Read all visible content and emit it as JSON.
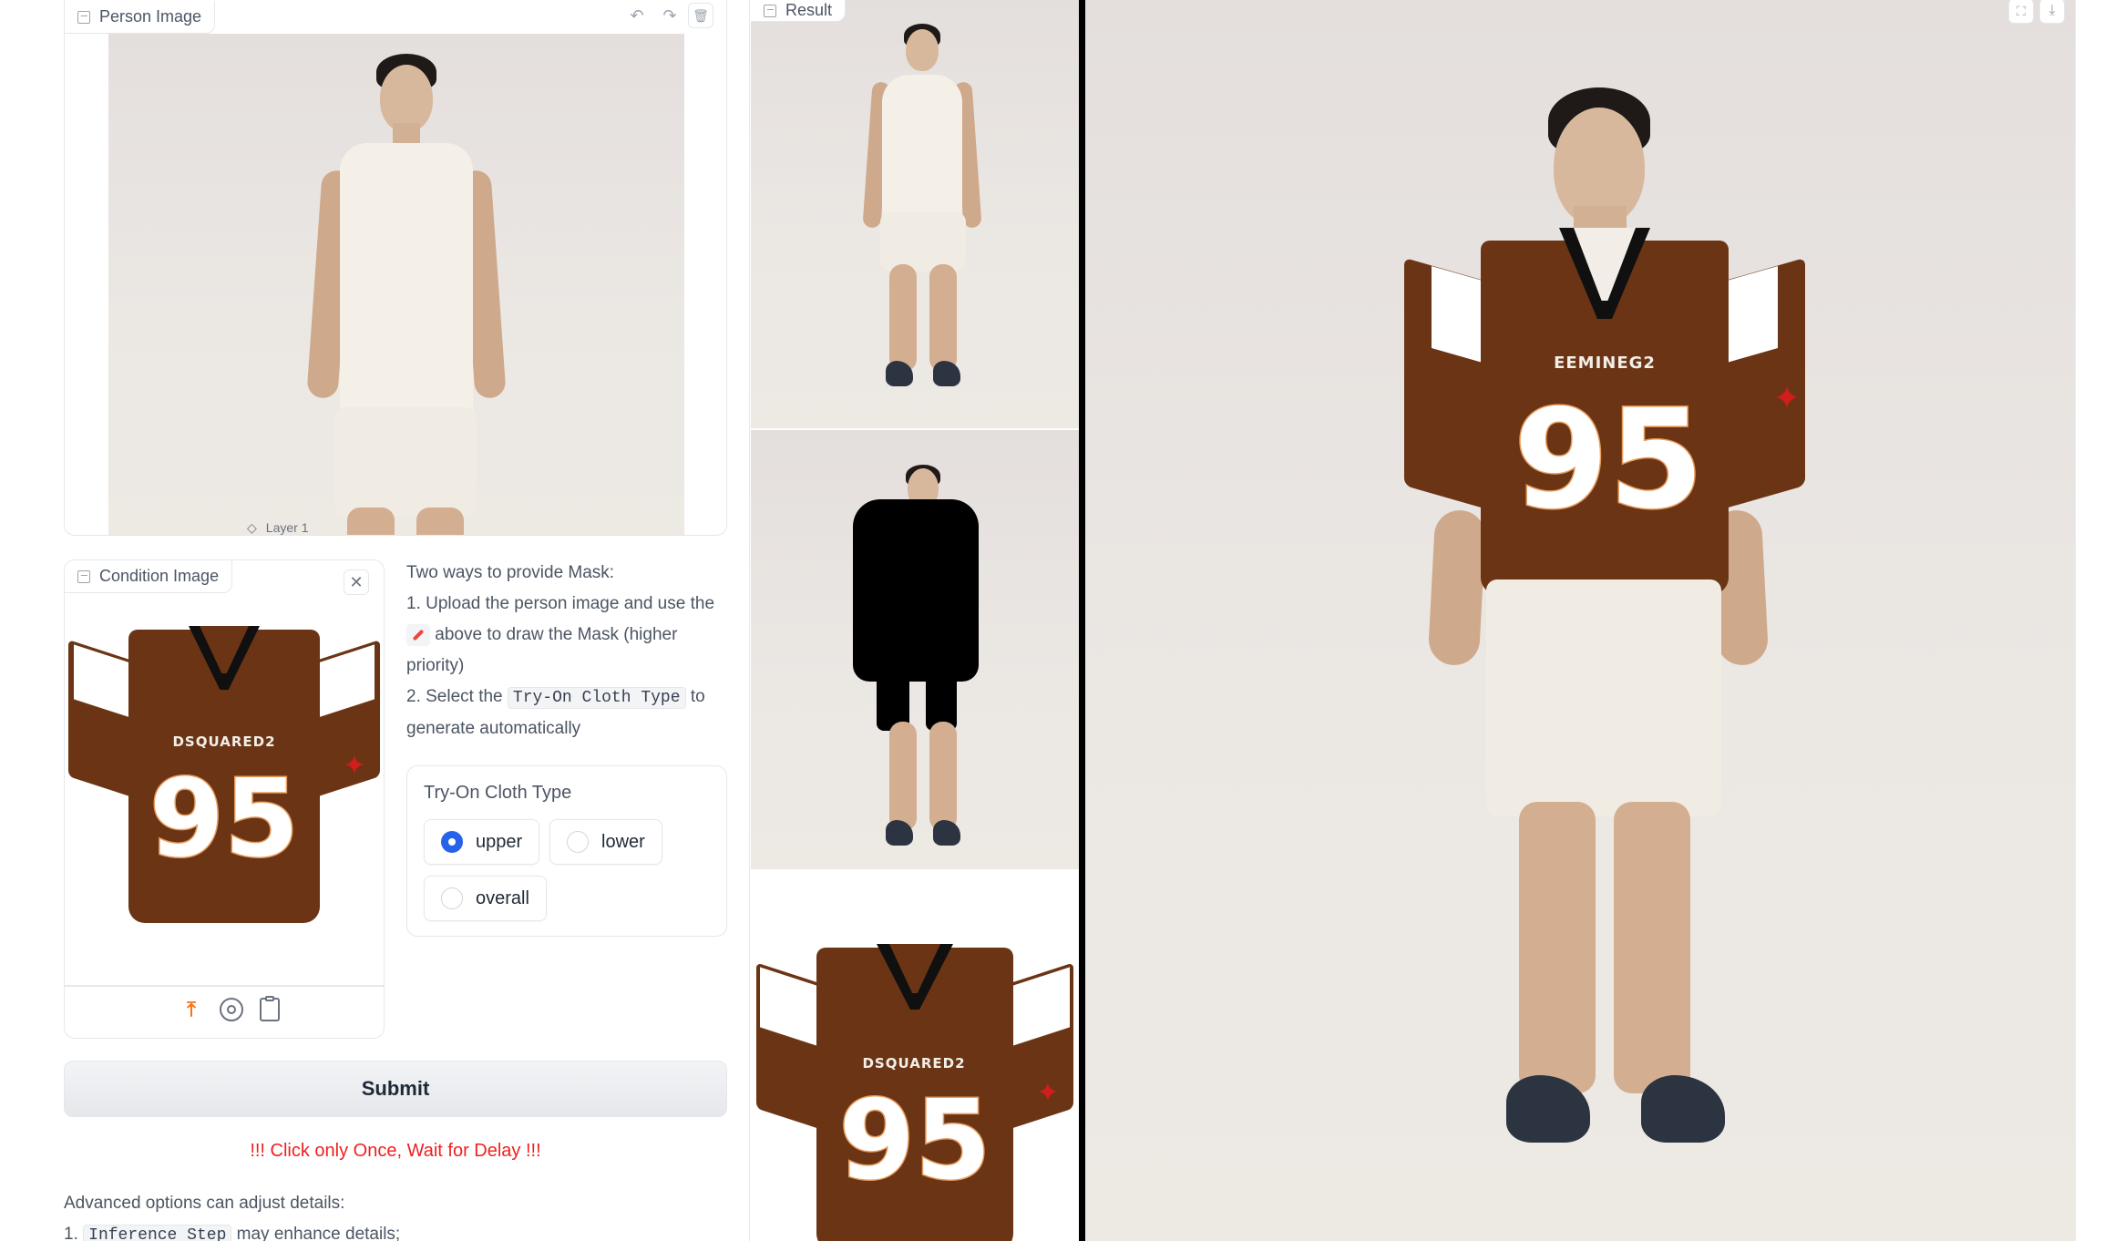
{
  "person_panel": {
    "label": "Person Image",
    "layer_label": "Layer 1",
    "undo_icon": "undo-icon",
    "redo_icon": "redo-icon",
    "trash_icon": "trash-icon"
  },
  "condition_panel": {
    "label": "Condition Image",
    "close_icon": "close-icon",
    "toolbar_icons": [
      "upload-icon",
      "webcam-icon",
      "clipboard-icon"
    ]
  },
  "instructions": {
    "line1": "Two ways to provide Mask:",
    "line2_a": "1. Upload the person image and use the",
    "line2_b": "above to draw the Mask (higher",
    "line2_c": "priority)",
    "line3_a": "2. Select the",
    "line3_code": "Try-On Cloth Type",
    "line3_b": "to",
    "line3_c": "generate automatically"
  },
  "cloth_type": {
    "label": "Try-On Cloth Type",
    "options": [
      {
        "label": "upper",
        "selected": true
      },
      {
        "label": "lower",
        "selected": false
      },
      {
        "label": "overall",
        "selected": false
      }
    ]
  },
  "submit": {
    "label": "Submit"
  },
  "warning": {
    "text": "!!! Click only Once, Wait for Delay !!!",
    "color": "#ef2020"
  },
  "advanced": {
    "line1": "Advanced options can adjust details:",
    "line2_prefix": "1.",
    "line2_code": "Inference Step",
    "line2_suffix": "may enhance details;"
  },
  "result_panel": {
    "label": "Result",
    "fullscreen_icon": "fullscreen-icon",
    "download_icon": "download-icon"
  },
  "jersey": {
    "brand": "DSQUARED2",
    "brand_result": "EEMINEG2",
    "number": "95"
  },
  "colors": {
    "accent": "#2563eb",
    "upload_icon": "#f97316",
    "jersey_brown": "#6b3515"
  }
}
